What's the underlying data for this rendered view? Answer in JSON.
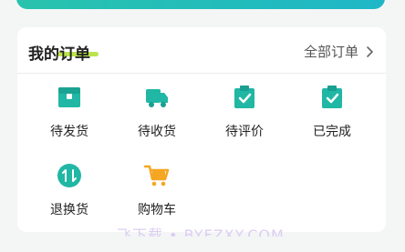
{
  "section": {
    "title": "我的订单",
    "all_orders_label": "全部订单",
    "items": [
      {
        "label": "待发货",
        "icon": "box-icon"
      },
      {
        "label": "待收货",
        "icon": "truck-icon"
      },
      {
        "label": "待评价",
        "icon": "clipboard-check-icon"
      },
      {
        "label": "已完成",
        "icon": "clipboard-check-icon"
      },
      {
        "label": "退换货",
        "icon": "exchange-icon"
      },
      {
        "label": "购物车",
        "icon": "cart-icon"
      }
    ]
  },
  "watermark": "飞下载 • BYFZXY.COM",
  "colors": {
    "accent": "#20b7a4",
    "highlight": "#b3e03a",
    "cart": "#f5a623"
  }
}
